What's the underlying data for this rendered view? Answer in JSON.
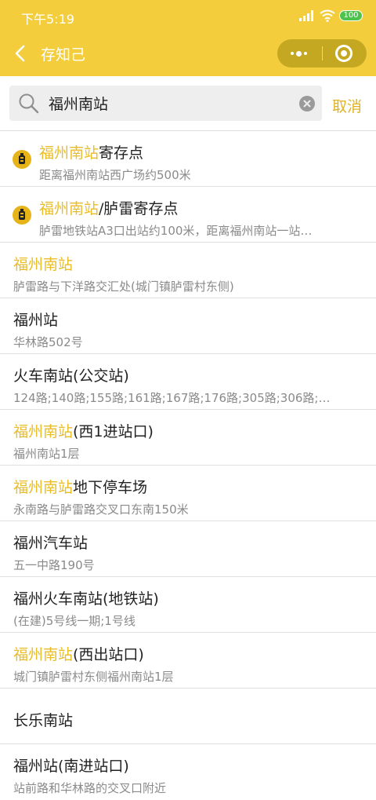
{
  "status_bar": {
    "time": "下午5:19",
    "battery": "100"
  },
  "header": {
    "title": "存知己"
  },
  "search": {
    "value": "福州南站",
    "cancel_label": "取消"
  },
  "colors": {
    "accent": "#f3cd3b",
    "highlight": "#e9bd2a",
    "pin": "#e6b418"
  },
  "results": [
    {
      "icon": "luggage-pin-icon",
      "highlight": "福州南站",
      "rest": "寄存点",
      "subtitle": "距离福州南站西广场约500米"
    },
    {
      "icon": "luggage-pin-icon",
      "highlight": "福州南站",
      "rest": "/胪雷寄存点",
      "subtitle": "胪雷地铁站A3口出站约100米，距离福州南站一站…"
    },
    {
      "highlight": "福州南站",
      "rest": "",
      "subtitle": "胪雷路与下洋路交汇处(城门镇胪雷村东侧)"
    },
    {
      "highlight": "",
      "rest": "福州站",
      "subtitle": "华林路502号"
    },
    {
      "highlight": "",
      "rest": "火车南站(公交站)",
      "subtitle": "124路;140路;155路;161路;167路;176路;305路;306路;…"
    },
    {
      "highlight": "福州南站",
      "rest": "(西1进站口)",
      "subtitle": "福州南站1层"
    },
    {
      "highlight": "福州南站",
      "rest": "地下停车场",
      "subtitle": "永南路与胪雷路交叉口东南150米"
    },
    {
      "highlight": "",
      "rest": "福州汽车站",
      "subtitle": "五一中路190号"
    },
    {
      "highlight": "",
      "rest": "福州火车南站(地铁站)",
      "subtitle": "(在建)5号线一期;1号线"
    },
    {
      "highlight": "福州南站",
      "rest": "(西出站口)",
      "subtitle": "城门镇胪雷村东侧福州南站1层"
    },
    {
      "highlight": "",
      "rest": "长乐南站",
      "subtitle": ""
    },
    {
      "highlight": "",
      "rest": "福州站(南进站口)",
      "subtitle": "站前路和华林路的交叉口附近"
    }
  ]
}
